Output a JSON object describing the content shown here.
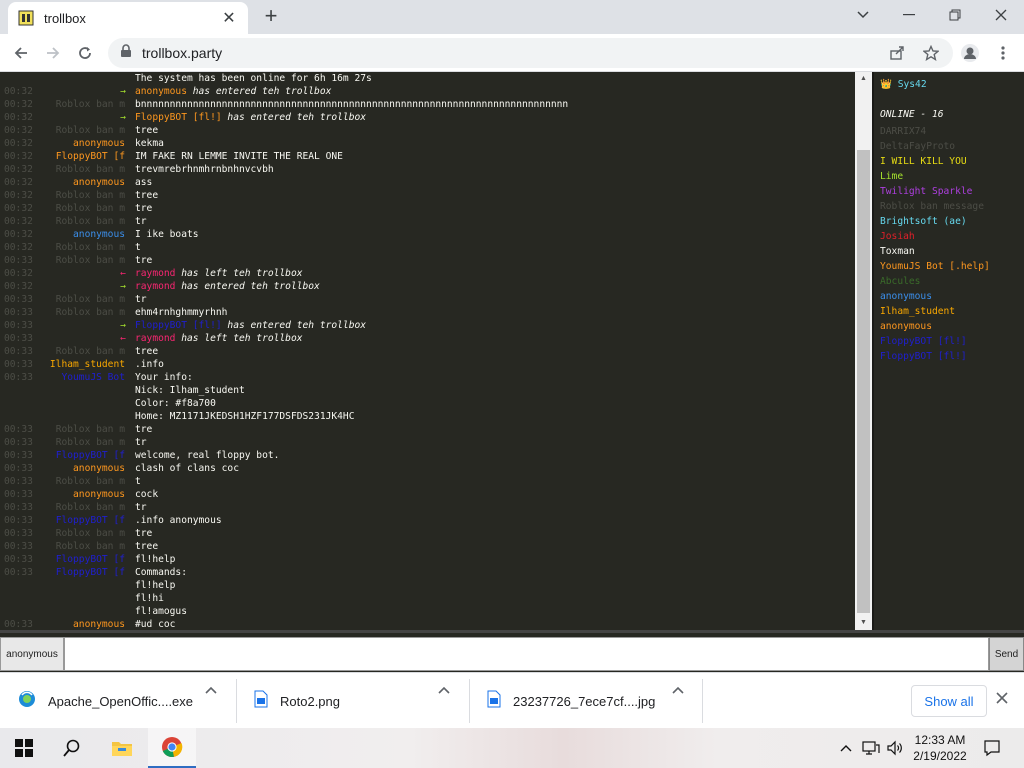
{
  "browser": {
    "tab_title": "trollbox",
    "url": "trollbox.party",
    "new_tab": "+",
    "tab_close": "✕"
  },
  "chat": {
    "messages": [
      {
        "time": "",
        "nick": "",
        "nick_color": "#4c4d46",
        "arrow": "",
        "arrow_color": "",
        "text": "The system has been online for 6h 16m 27s",
        "text_color": "#f8f8f2",
        "sys": ""
      },
      {
        "time": "00:32",
        "nick": "",
        "nick_color": "#4c4d46",
        "arrow": "→",
        "arrow_color": "#a6e22e",
        "text": "anonymous",
        "text_color": "#fd971f",
        "sys": " has entered teh trollbox"
      },
      {
        "time": "00:32",
        "nick": "Roblox ban m",
        "nick_color": "#4c4d46",
        "arrow": "",
        "arrow_color": "",
        "text": "bnnnnnnnnnnnnnnnnnnnnnnnnnnnnnnnnnnnnnnnnnnnnnnnnnnnnnnnnnnnnnnnnnnnnnnnnnn",
        "text_color": "#f8f8f2",
        "sys": ""
      },
      {
        "time": "00:32",
        "nick": "",
        "nick_color": "#4c4d46",
        "arrow": "→",
        "arrow_color": "#a6e22e",
        "text": "FloppyBOT [fl!]",
        "text_color": "#fd971f",
        "sys": " has entered teh trollbox"
      },
      {
        "time": "00:32",
        "nick": "Roblox ban m",
        "nick_color": "#4c4d46",
        "arrow": "",
        "arrow_color": "",
        "text": "tree",
        "text_color": "#f8f8f2",
        "sys": ""
      },
      {
        "time": "00:32",
        "nick": "anonymous",
        "nick_color": "#fd971f",
        "arrow": "",
        "arrow_color": "",
        "text": "kekma",
        "text_color": "#f8f8f2",
        "sys": ""
      },
      {
        "time": "00:32",
        "nick": "FloppyBOT [f",
        "nick_color": "#fd971f",
        "arrow": "",
        "arrow_color": "",
        "text": "IM FAKE RN LEMME INVITE THE REAL ONE",
        "text_color": "#f8f8f2",
        "sys": ""
      },
      {
        "time": "00:32",
        "nick": "Roblox ban m",
        "nick_color": "#4c4d46",
        "arrow": "",
        "arrow_color": "",
        "text": "trevmrebrhnmhrnbnhnvcvbh",
        "text_color": "#f8f8f2",
        "sys": ""
      },
      {
        "time": "00:32",
        "nick": "anonymous",
        "nick_color": "#fd971f",
        "arrow": "",
        "arrow_color": "",
        "text": "ass",
        "text_color": "#f8f8f2",
        "sys": ""
      },
      {
        "time": "00:32",
        "nick": "Roblox ban m",
        "nick_color": "#4c4d46",
        "arrow": "",
        "arrow_color": "",
        "text": "tree",
        "text_color": "#f8f8f2",
        "sys": ""
      },
      {
        "time": "00:32",
        "nick": "Roblox ban m",
        "nick_color": "#4c4d46",
        "arrow": "",
        "arrow_color": "",
        "text": "tre",
        "text_color": "#f8f8f2",
        "sys": ""
      },
      {
        "time": "00:32",
        "nick": "Roblox ban m",
        "nick_color": "#4c4d46",
        "arrow": "",
        "arrow_color": "",
        "text": "tr",
        "text_color": "#f8f8f2",
        "sys": ""
      },
      {
        "time": "00:32",
        "nick": "anonymous",
        "nick_color": "#3b8eea",
        "arrow": "",
        "arrow_color": "",
        "text": "I ike boats",
        "text_color": "#f8f8f2",
        "sys": ""
      },
      {
        "time": "00:32",
        "nick": "Roblox ban m",
        "nick_color": "#4c4d46",
        "arrow": "",
        "arrow_color": "",
        "text": "t",
        "text_color": "#f8f8f2",
        "sys": ""
      },
      {
        "time": "00:33",
        "nick": "Roblox ban m",
        "nick_color": "#4c4d46",
        "arrow": "",
        "arrow_color": "",
        "text": "tre",
        "text_color": "#f8f8f2",
        "sys": ""
      },
      {
        "time": "00:32",
        "nick": "",
        "nick_color": "#4c4d46",
        "arrow": "←",
        "arrow_color": "#f92672",
        "text": "raymond",
        "text_color": "#f92672",
        "sys": " has left teh trollbox"
      },
      {
        "time": "00:32",
        "nick": "",
        "nick_color": "#4c4d46",
        "arrow": "→",
        "arrow_color": "#a6e22e",
        "text": "raymond",
        "text_color": "#f92672",
        "sys": " has entered teh trollbox"
      },
      {
        "time": "00:33",
        "nick": "Roblox ban m",
        "nick_color": "#4c4d46",
        "arrow": "",
        "arrow_color": "",
        "text": "tr",
        "text_color": "#f8f8f2",
        "sys": ""
      },
      {
        "time": "00:33",
        "nick": "Roblox ban m",
        "nick_color": "#4c4d46",
        "arrow": "",
        "arrow_color": "",
        "text": "ehm4rnhghmmyrhnh",
        "text_color": "#f8f8f2",
        "sys": ""
      },
      {
        "time": "00:33",
        "nick": "",
        "nick_color": "#4c4d46",
        "arrow": "→",
        "arrow_color": "#a6e22e",
        "text": "FloppyBOT [fl!]",
        "text_color": "#1f1fd0",
        "sys": " has entered teh trollbox"
      },
      {
        "time": "00:33",
        "nick": "",
        "nick_color": "#4c4d46",
        "arrow": "←",
        "arrow_color": "#f92672",
        "text": "raymond",
        "text_color": "#f92672",
        "sys": " has left teh trollbox"
      },
      {
        "time": "00:33",
        "nick": "Roblox ban m",
        "nick_color": "#4c4d46",
        "arrow": "",
        "arrow_color": "",
        "text": "tree",
        "text_color": "#f8f8f2",
        "sys": ""
      },
      {
        "time": "00:33",
        "nick": "Ilham_student",
        "nick_color": "#f8a700",
        "arrow": "",
        "arrow_color": "",
        "text": ".info",
        "text_color": "#f8f8f2",
        "sys": ""
      },
      {
        "time": "00:33",
        "nick": "YoumuJS Bot",
        "nick_color": "#1f1fd0",
        "arrow": "",
        "arrow_color": "",
        "text": "Your info:",
        "text_color": "#f8f8f2",
        "sys": ""
      },
      {
        "time": "",
        "nick": "",
        "nick_color": "#4c4d46",
        "arrow": "",
        "arrow_color": "",
        "text": "Nick:  Ilham_student",
        "text_color": "#f8f8f2",
        "sys": ""
      },
      {
        "time": "",
        "nick": "",
        "nick_color": "#4c4d46",
        "arrow": "",
        "arrow_color": "",
        "text": "Color: #f8a700",
        "text_color": "#f8f8f2",
        "sys": ""
      },
      {
        "time": "",
        "nick": "",
        "nick_color": "#4c4d46",
        "arrow": "",
        "arrow_color": "",
        "text": "Home:  MZ1171JKEDSH1HZF177DSFDS231JK4HC",
        "text_color": "#f8f8f2",
        "sys": ""
      },
      {
        "time": "00:33",
        "nick": "Roblox ban m",
        "nick_color": "#4c4d46",
        "arrow": "",
        "arrow_color": "",
        "text": "tre",
        "text_color": "#f8f8f2",
        "sys": ""
      },
      {
        "time": "00:33",
        "nick": "Roblox ban m",
        "nick_color": "#4c4d46",
        "arrow": "",
        "arrow_color": "",
        "text": "tr",
        "text_color": "#f8f8f2",
        "sys": ""
      },
      {
        "time": "00:33",
        "nick": "FloppyBOT [f",
        "nick_color": "#1f1fd0",
        "arrow": "",
        "arrow_color": "",
        "text": "welcome, real floppy bot.",
        "text_color": "#f8f8f2",
        "sys": ""
      },
      {
        "time": "00:33",
        "nick": "anonymous",
        "nick_color": "#fd971f",
        "arrow": "",
        "arrow_color": "",
        "text": "clash of clans coc",
        "text_color": "#f8f8f2",
        "sys": ""
      },
      {
        "time": "00:33",
        "nick": "Roblox ban m",
        "nick_color": "#4c4d46",
        "arrow": "",
        "arrow_color": "",
        "text": "t",
        "text_color": "#f8f8f2",
        "sys": ""
      },
      {
        "time": "00:33",
        "nick": "anonymous",
        "nick_color": "#fd971f",
        "arrow": "",
        "arrow_color": "",
        "text": "cock",
        "text_color": "#f8f8f2",
        "sys": ""
      },
      {
        "time": "00:33",
        "nick": "Roblox ban m",
        "nick_color": "#4c4d46",
        "arrow": "",
        "arrow_color": "",
        "text": "tr",
        "text_color": "#f8f8f2",
        "sys": ""
      },
      {
        "time": "00:33",
        "nick": "FloppyBOT [f",
        "nick_color": "#1f1fd0",
        "arrow": "",
        "arrow_color": "",
        "text": ".info anonymous",
        "text_color": "#f8f8f2",
        "sys": ""
      },
      {
        "time": "00:33",
        "nick": "Roblox ban m",
        "nick_color": "#4c4d46",
        "arrow": "",
        "arrow_color": "",
        "text": "tre",
        "text_color": "#f8f8f2",
        "sys": ""
      },
      {
        "time": "00:33",
        "nick": "Roblox ban m",
        "nick_color": "#4c4d46",
        "arrow": "",
        "arrow_color": "",
        "text": "tree",
        "text_color": "#f8f8f2",
        "sys": ""
      },
      {
        "time": "00:33",
        "nick": "FloppyBOT [f",
        "nick_color": "#1f1fd0",
        "arrow": "",
        "arrow_color": "",
        "text": "fl!help",
        "text_color": "#f8f8f2",
        "sys": ""
      },
      {
        "time": "00:33",
        "nick": "FloppyBOT [f",
        "nick_color": "#1f1fd0",
        "arrow": "",
        "arrow_color": "",
        "text": "Commands:",
        "text_color": "#f8f8f2",
        "sys": ""
      },
      {
        "time": "",
        "nick": "",
        "nick_color": "#4c4d46",
        "arrow": "",
        "arrow_color": "",
        "text": "fl!help",
        "text_color": "#f8f8f2",
        "sys": ""
      },
      {
        "time": "",
        "nick": "",
        "nick_color": "#4c4d46",
        "arrow": "",
        "arrow_color": "",
        "text": "fl!hi",
        "text_color": "#f8f8f2",
        "sys": ""
      },
      {
        "time": "",
        "nick": "",
        "nick_color": "#4c4d46",
        "arrow": "",
        "arrow_color": "",
        "text": "fl!amogus",
        "text_color": "#f8f8f2",
        "sys": ""
      },
      {
        "time": "00:33",
        "nick": "anonymous",
        "nick_color": "#fd971f",
        "arrow": "",
        "arrow_color": "",
        "text": "#ud coc",
        "text_color": "#f8f8f2",
        "sys": ""
      }
    ]
  },
  "userlist": {
    "title": "👑 Sys42",
    "title_color": "#66d9ef",
    "online": "ONLINE - 16",
    "users": [
      {
        "name": "DARRIX74",
        "color": "#4c4d46"
      },
      {
        "name": "DeltaFayProto",
        "color": "#4c4d46"
      },
      {
        "name": "I WILL KILL YOU",
        "color": "#e6db14"
      },
      {
        "name": "Lime",
        "color": "#a6e22e"
      },
      {
        "name": "Twilight Sparkle",
        "color": "#ae3fe0"
      },
      {
        "name": "Roblox ban message",
        "color": "#4c4d46"
      },
      {
        "name": "Brightsoft (ae)",
        "color": "#66d9ef"
      },
      {
        "name": "Josiah",
        "color": "#e0202a"
      },
      {
        "name": "Toxman",
        "color": "#f8f8f2"
      },
      {
        "name": "YoumuJS Bot [.help]",
        "color": "#fd971f"
      },
      {
        "name": "Abcules",
        "color": "#3a6b2a"
      },
      {
        "name": "anonymous",
        "color": "#3b8eea"
      },
      {
        "name": "Ilham_student",
        "color": "#f8a700"
      },
      {
        "name": "anonymous",
        "color": "#fd971f"
      },
      {
        "name": "FloppyBOT [fl!]",
        "color": "#1f1fd0"
      },
      {
        "name": "FloppyBOT [fl!]",
        "color": "#1f1fd0"
      }
    ]
  },
  "input": {
    "nick": "anonymous",
    "value": "",
    "send_label": "Send"
  },
  "downloads": {
    "items": [
      {
        "name": "Apache_OpenOffic....exe",
        "icon": "installer-icon"
      },
      {
        "name": "Roto2.png",
        "icon": "image-file-icon"
      },
      {
        "name": "23237726_7ece7cf....jpg",
        "icon": "image-file-icon"
      }
    ],
    "show_all": "Show all"
  },
  "taskbar": {
    "time": "12:33 AM",
    "date": "2/19/2022"
  }
}
